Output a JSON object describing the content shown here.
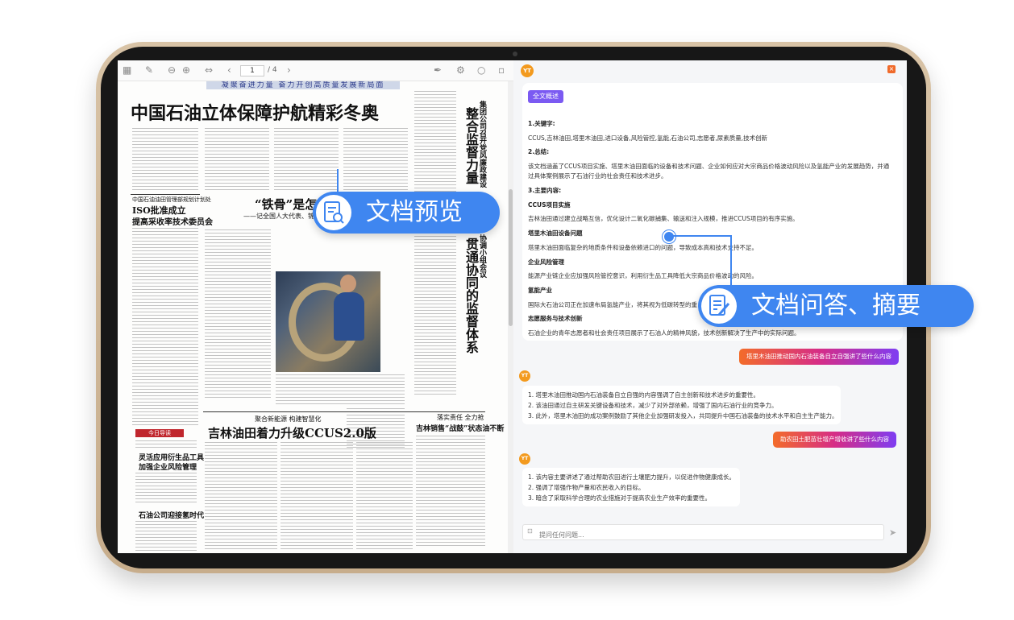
{
  "viewer": {
    "page_current": "1",
    "page_sep_total": "/ 4"
  },
  "newspaper": {
    "banner": "凝聚奋进力量 奋力开创高质量发展新局面",
    "headline1": "中国石油立体保障护航精彩冬奥",
    "subhead_left1": "中国石油油田管理部规划计划处",
    "headline_left2": "ISO批准成立",
    "headline_left3": "提高采收率技术委员会",
    "headline_center": "“铁骨”是怎样",
    "subline_center": "——记全国人大代表、锦西石",
    "vertical_headline": "整合监督力量",
    "vertical_headline2": "贯通协同的监督体系",
    "vertical_small": "集团公司召开党风廉政建设",
    "vertical_small2": "协调小组会议",
    "box_label": "今日导读",
    "box_title1": "灵活应用衍生品工具",
    "box_title2": "加强企业风险管理",
    "box_title3": "石油公司迎接氢时代",
    "tagline": "聚合新能源 构建智慧化",
    "headline_bottom": "吉林油田着力升级CCUS2.0版",
    "tagline_right": "落实责任 全力抢",
    "headline_bottom_right": "吉林销售“战鼓”状态油不断"
  },
  "assistant": {
    "logo": "YT",
    "close": "×",
    "summary_badge": "全文概述",
    "s1_title": "1.关键字:",
    "s1_text": "CCUS,吉林油田,塔里木油田,进口设备,风险管控,氢能,石油公司,志愿者,尿素质量,技术创新",
    "s2_title": "2.总结:",
    "s2_text_line1": "该文档涵盖了CCUS项目实施、塔里木油田面临的设备和技术问题、企业如何应对大宗商品价格波动风险以及氢能产业的发展趋势，并通",
    "s2_text_line2": "过具体案例展示了石油行业的社会责任和技术进步。",
    "s3_title": "3.主要内容:",
    "items": [
      {
        "title": "CCUS项目实施",
        "text": "吉林油田通过建立战略互信，优化设计二氧化碳捕集、输送和注入规模，推进CCUS项目的有序实施。"
      },
      {
        "title": "塔里木油田设备问题",
        "text": "塔里木油田面临复杂的地质条件和设备依赖进口的问题，导致成本高和技术支持不足。"
      },
      {
        "title": "企业风险管理",
        "text": "能源产业链企业应加强风险管控意识，利用衍生品工具降低大宗商品价格波动的风险。"
      },
      {
        "title": "氢能产业",
        "text": "国际大石油公司正在加速布局氢能产业，将其视为低碳转型的重"
      },
      {
        "title": "志愿服务与技术创新",
        "text": "石油企业的青年志愿者和社会责任项目展示了石油人的精神风貌，技术创新解决了生产中的实际问题。"
      }
    ],
    "q1": "塔里木油田推动国内石油装备自立自强讲了些什么内容",
    "a1": [
      "1. 塔里木油田推动国内石油装备自立自强的内容强调了自主创新和技术进步的重要性。",
      "2. 该油田通过自主研发关键设备和技术，减少了对外部依赖，增强了国内石油行业的竞争力。",
      "3. 此外，塔里木油田的成功案例鼓励了其他企业加强研发投入，共同提升中国石油装备的技术水平和自主生产能力。"
    ],
    "q2": "助农田土肥苗壮增产增收讲了些什么内容",
    "a2": [
      "1. 该内容主要讲述了通过帮助农田进行土壤肥力提升，以促进作物健康成长。",
      "2. 强调了增强作物产量和农民收入的目标。",
      "3. 暗含了采取科学合理的农业措施对于提高农业生产效率的重要性。"
    ],
    "input_placeholder": "提问任何问题..."
  },
  "callouts": {
    "preview": "文档预览",
    "qa": "文档问答、摘要"
  },
  "colors": {
    "accent_blue": "#3f86f0",
    "badge_purple": "#7b5af2",
    "brand_orange": "#f39a1e"
  }
}
